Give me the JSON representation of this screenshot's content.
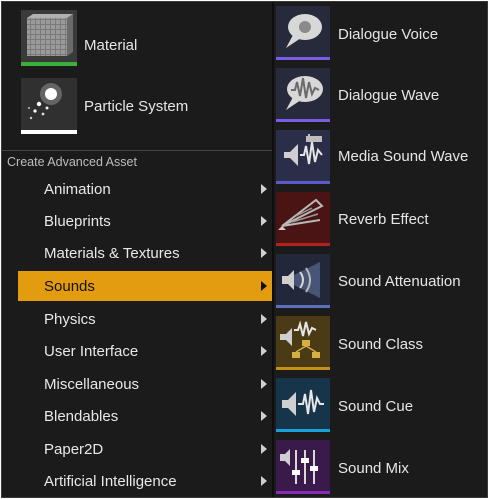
{
  "top_assets": [
    {
      "label": "Material",
      "icon": "material-icon",
      "bar_color": "#3cae3c"
    },
    {
      "label": "Particle System",
      "icon": "particle-system-icon",
      "bar_color": "#ffffff"
    }
  ],
  "section_header": "Create Advanced Asset",
  "categories": [
    {
      "label": "Animation"
    },
    {
      "label": "Blueprints"
    },
    {
      "label": "Materials & Textures"
    },
    {
      "label": "Sounds",
      "selected": true
    },
    {
      "label": "Physics"
    },
    {
      "label": "User Interface"
    },
    {
      "label": "Miscellaneous"
    },
    {
      "label": "Blendables"
    },
    {
      "label": "Paper2D"
    },
    {
      "label": "Artificial Intelligence"
    }
  ],
  "sound_assets": [
    {
      "label": "Dialogue Voice",
      "icon": "dialogue-voice-icon",
      "bar_color": "#7a5ce6"
    },
    {
      "label": "Dialogue Wave",
      "icon": "dialogue-wave-icon",
      "bar_color": "#7a5ce6"
    },
    {
      "label": "Media Sound Wave",
      "icon": "media-sound-wave-icon",
      "bar_color": "#5a5ac8"
    },
    {
      "label": "Reverb Effect",
      "icon": "reverb-effect-icon",
      "bar_color": "#b4201e"
    },
    {
      "label": "Sound Attenuation",
      "icon": "sound-attenuation-icon",
      "bar_color": "#5a70b8"
    },
    {
      "label": "Sound Class",
      "icon": "sound-class-icon",
      "bar_color": "#c49018"
    },
    {
      "label": "Sound Cue",
      "icon": "sound-cue-icon",
      "bar_color": "#1aa0d8"
    },
    {
      "label": "Sound Mix",
      "icon": "sound-mix-icon",
      "bar_color": "#8a2ab8"
    }
  ]
}
